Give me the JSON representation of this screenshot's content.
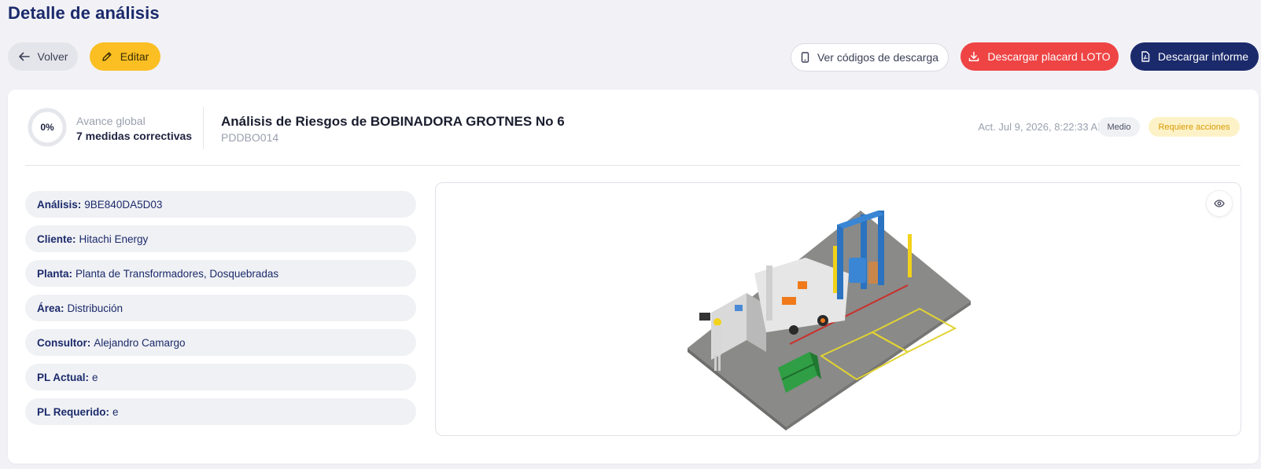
{
  "page": {
    "title": "Detalle de análisis"
  },
  "toolbar": {
    "back_label": "Volver",
    "edit_label": "Editar",
    "codes_label": "Ver códigos de descarga",
    "placard_label": "Descargar placard LOTO",
    "report_label": "Descargar informe"
  },
  "summary": {
    "progress_percent": "0%",
    "progress_value": 0,
    "progress_label": "Avance global",
    "measures": "7 medidas correctivas",
    "title": "Análisis de Riesgos de BOBINADORA GROTNES No 6",
    "code": "PDDBO014",
    "updated": "Act. Jul 9, 2026, 8:22:33 AM",
    "level_badge": "Medio",
    "status_badge": "Requiere acciones"
  },
  "details": [
    {
      "key": "Análisis:",
      "value": "9BE840DA5D03"
    },
    {
      "key": "Cliente:",
      "value": "Hitachi Energy"
    },
    {
      "key": "Planta:",
      "value": "Planta de Transformadores, Dosquebradas"
    },
    {
      "key": "Área:",
      "value": "Distribución"
    },
    {
      "key": "Consultor:",
      "value": "Alejandro Camargo"
    },
    {
      "key": "PL Actual:",
      "value": "e"
    },
    {
      "key": "PL Requerido:",
      "value": "e"
    }
  ],
  "icons": {
    "back": "arrow-left-icon",
    "edit": "pencil-icon",
    "codes": "mobile-phone-icon",
    "placard": "download-icon",
    "report": "pdf-file-icon",
    "view": "eye-icon"
  },
  "colors": {
    "primary": "#1b2a6b",
    "warning": "#fbbf24",
    "danger": "#ef4444",
    "status_badge_bg": "#fdf2c7",
    "status_badge_text": "#d99a06"
  }
}
